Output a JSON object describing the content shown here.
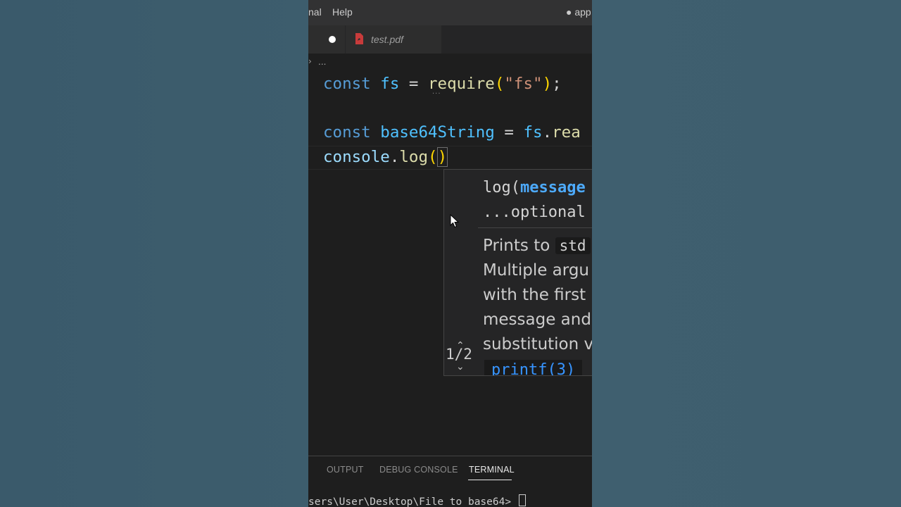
{
  "titlebar": {
    "menu_fragment": "nal",
    "help": "Help",
    "window_title": "● app."
  },
  "tabs": [
    {
      "label": "test.pdf",
      "icon": "pdf-file-icon"
    }
  ],
  "breadcrumb": {
    "text": "..."
  },
  "editor": {
    "line1": {
      "kw": "const",
      "name": "fs",
      "eq": "=",
      "fn": "require",
      "open": "(",
      "arg": "\"fs\"",
      "close": ")",
      "semi": ";"
    },
    "line2": {
      "kw": "const",
      "name": "base64String",
      "eq": "=",
      "obj": "fs",
      "dot": ".",
      "method": "rea"
    },
    "line3": {
      "obj": "console",
      "dot": ".",
      "method": "log",
      "open": "(",
      "close": ")"
    }
  },
  "hover": {
    "counter": "1/2",
    "signature_line1_prefix": "log(",
    "signature_param": "message",
    "signature_line2": "...optional",
    "doc_lines": [
      "Prints to ",
      "Multiple argu",
      "with the first u",
      "message and ",
      "substitution v"
    ],
    "inline_code": "std",
    "doc_link": "printf(3)"
  },
  "panel": {
    "tabs": [
      "OUTPUT",
      "DEBUG CONSOLE",
      "TERMINAL"
    ],
    "active_tab": "TERMINAL",
    "terminal_text": "sers\\User\\Desktop\\File to base64> "
  },
  "colors": {
    "keyword": "#569cd6",
    "variable": "#4fc1ff",
    "function": "#dcdcaa",
    "string": "#ce9178",
    "bracket": "#ffd700",
    "editor_bg": "#1e1e1e"
  }
}
